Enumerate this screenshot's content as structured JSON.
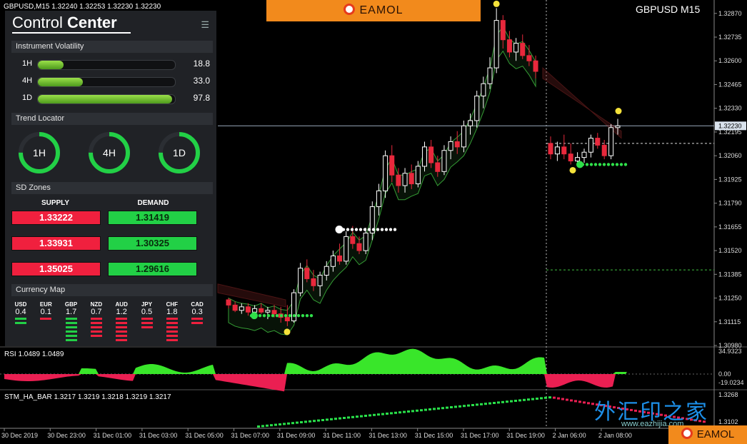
{
  "symbol_header": "GBPUSD,M15  1.32240 1.32253 1.32230 1.32230",
  "chart_title": "GBPUSD M15",
  "brand": "EAMOL",
  "colors": {
    "bull": "#ffffff",
    "bear": "#e8283c",
    "rsi_pos": "#39e62a",
    "rsi_neg": "#ea1f52",
    "band_up": "#3fbf3f",
    "band_down": "#d43b3b",
    "zone_supply": "#f0203e",
    "zone_demand": "#22d046",
    "accent": "#f28a1c"
  },
  "control_center": {
    "title_light": "Control ",
    "title_bold": "Center",
    "menu_icon": "hamburger-icon",
    "volatility": {
      "heading": "Instrument Volatility",
      "rows": [
        {
          "label": "1H",
          "value": "18.8",
          "fill": 0.188
        },
        {
          "label": "4H",
          "value": "33.0",
          "fill": 0.33
        },
        {
          "label": "1D",
          "value": "97.8",
          "fill": 0.978
        }
      ]
    },
    "trend_locator": {
      "heading": "Trend Locator",
      "rings": [
        {
          "label": "1H",
          "fill": 0.75
        },
        {
          "label": "4H",
          "fill": 0.75
        },
        {
          "label": "1D",
          "fill": 0.75
        }
      ]
    },
    "sd_zones": {
      "heading": "SD Zones",
      "supply_label": "SUPPLY",
      "demand_label": "DEMAND",
      "supply": [
        "1.33222",
        "1.33931",
        "1.35025"
      ],
      "demand": [
        "1.31419",
        "1.30325",
        "1.29616"
      ]
    },
    "currency_map": {
      "heading": "Currency Map",
      "items": [
        {
          "name": "USD",
          "value": "0.4",
          "bars": 2,
          "color": "#22d046"
        },
        {
          "name": "EUR",
          "value": "0.1",
          "bars": 1,
          "color": "#f0203e"
        },
        {
          "name": "GBP",
          "value": "1.7",
          "bars": 6,
          "color": "#22d046"
        },
        {
          "name": "NZD",
          "value": "0.7",
          "bars": 5,
          "color": "#f0203e"
        },
        {
          "name": "AUD",
          "value": "1.2",
          "bars": 6,
          "color": "#f0203e"
        },
        {
          "name": "JPY",
          "value": "0.5",
          "bars": 3,
          "color": "#f0203e"
        },
        {
          "name": "CHF",
          "value": "1.8",
          "bars": 6,
          "color": "#f0203e"
        },
        {
          "name": "CAD",
          "value": "0.3",
          "bars": 2,
          "color": "#f0203e"
        }
      ]
    }
  },
  "price_axis": [
    "1.32870",
    "1.32735",
    "1.32600",
    "1.32465",
    "1.32330",
    "1.32195",
    "1.32060",
    "1.31925",
    "1.31790",
    "1.31655",
    "1.31520",
    "1.31385",
    "1.31250",
    "1.31115",
    "1.30980"
  ],
  "current_price": "1.32230",
  "rsi": {
    "label": "RSI 1.0489 1.0489",
    "levels": [
      "34.9323",
      "0.00",
      "-19.0234"
    ]
  },
  "stm": {
    "label": "STM_HA_BAR 1.3217 1.3219 1.3218 1.3219 1.3217",
    "levels": [
      "1.3268",
      "1.3102"
    ]
  },
  "time_axis": [
    "30 Dec 2019",
    "30 Dec 23:00",
    "31 Dec 01:00",
    "31 Dec 03:00",
    "31 Dec 05:00",
    "31 Dec 07:00",
    "31 Dec 09:00",
    "31 Dec 11:00",
    "31 Dec 13:00",
    "31 Dec 15:00",
    "31 Dec 17:00",
    "31 Dec 19:00",
    "2 Jan 06:00",
    "2 Jan 08:00"
  ],
  "watermark": {
    "text": "外汇印之家",
    "url": "www.eazhijia.com"
  },
  "chart_data": {
    "type": "candlestick",
    "title": "GBPUSD M15",
    "ylim": [
      1.3098,
      1.3293
    ],
    "candles": [
      [
        1.3124,
        1.3125,
        1.3119,
        1.3121
      ],
      [
        1.3121,
        1.3123,
        1.3117,
        1.3118
      ],
      [
        1.3118,
        1.3122,
        1.3116,
        1.312
      ],
      [
        1.312,
        1.3122,
        1.3115,
        1.3117
      ],
      [
        1.3117,
        1.3121,
        1.3114,
        1.3119
      ],
      [
        1.3119,
        1.3122,
        1.3116,
        1.3117
      ],
      [
        1.3117,
        1.312,
        1.3113,
        1.3118
      ],
      [
        1.3118,
        1.3121,
        1.3114,
        1.3116
      ],
      [
        1.3116,
        1.312,
        1.3111,
        1.3114
      ],
      [
        1.3114,
        1.3121,
        1.3109,
        1.3112
      ],
      [
        1.3112,
        1.313,
        1.3111,
        1.3128
      ],
      [
        1.3128,
        1.3145,
        1.3126,
        1.3142
      ],
      [
        1.3142,
        1.3147,
        1.3134,
        1.3136
      ],
      [
        1.3136,
        1.3141,
        1.3129,
        1.3132
      ],
      [
        1.3132,
        1.314,
        1.3126,
        1.3138
      ],
      [
        1.3138,
        1.3146,
        1.3135,
        1.3143
      ],
      [
        1.3143,
        1.3152,
        1.314,
        1.3149
      ],
      [
        1.3149,
        1.3156,
        1.3144,
        1.3146
      ],
      [
        1.3146,
        1.3163,
        1.3144,
        1.316
      ],
      [
        1.316,
        1.3166,
        1.3153,
        1.3156
      ],
      [
        1.3156,
        1.316,
        1.315,
        1.3152
      ],
      [
        1.3152,
        1.3165,
        1.315,
        1.3162
      ],
      [
        1.3162,
        1.318,
        1.3158,
        1.3177
      ],
      [
        1.3177,
        1.319,
        1.3172,
        1.3186
      ],
      [
        1.3186,
        1.3209,
        1.3182,
        1.3206
      ],
      [
        1.3206,
        1.3212,
        1.3191,
        1.3195
      ],
      [
        1.3195,
        1.3199,
        1.3185,
        1.3189
      ],
      [
        1.3189,
        1.3199,
        1.3185,
        1.3196
      ],
      [
        1.3196,
        1.3201,
        1.3187,
        1.319
      ],
      [
        1.319,
        1.3203,
        1.3188,
        1.32
      ],
      [
        1.32,
        1.3214,
        1.3197,
        1.3211
      ],
      [
        1.3211,
        1.3215,
        1.3199,
        1.3202
      ],
      [
        1.3202,
        1.3206,
        1.3194,
        1.3197
      ],
      [
        1.3197,
        1.3212,
        1.3195,
        1.3209
      ],
      [
        1.3209,
        1.3217,
        1.3204,
        1.3214
      ],
      [
        1.3214,
        1.322,
        1.3207,
        1.3211
      ],
      [
        1.3211,
        1.3226,
        1.3208,
        1.3223
      ],
      [
        1.3223,
        1.323,
        1.3218,
        1.3226
      ],
      [
        1.3226,
        1.3243,
        1.3222,
        1.324
      ],
      [
        1.324,
        1.3251,
        1.3233,
        1.3247
      ],
      [
        1.3247,
        1.3262,
        1.3244,
        1.3256
      ],
      [
        1.3256,
        1.329,
        1.3253,
        1.3283
      ],
      [
        1.3283,
        1.3286,
        1.3267,
        1.3272
      ],
      [
        1.3272,
        1.3277,
        1.3262,
        1.3265
      ],
      [
        1.3265,
        1.3273,
        1.326,
        1.327
      ],
      [
        1.327,
        1.3275,
        1.3261,
        1.3263
      ],
      [
        1.3263,
        1.3269,
        1.3257,
        1.326
      ],
      [
        1.326,
        1.3263,
        1.325,
        1.3254
      ],
      [
        1.3213,
        1.3217,
        1.3204,
        1.3207
      ],
      [
        1.3207,
        1.3214,
        1.3203,
        1.3211
      ],
      [
        1.3211,
        1.3218,
        1.3204,
        1.3207
      ],
      [
        1.3207,
        1.3213,
        1.3201,
        1.3203
      ],
      [
        1.3203,
        1.3208,
        1.32,
        1.3205
      ],
      [
        1.3205,
        1.321,
        1.3202,
        1.3208
      ],
      [
        1.3208,
        1.3218,
        1.3205,
        1.3216
      ],
      [
        1.3216,
        1.3219,
        1.321,
        1.3212
      ],
      [
        1.3212,
        1.3215,
        1.3204,
        1.3206
      ],
      [
        1.3206,
        1.3224,
        1.3204,
        1.3222
      ],
      [
        1.3222,
        1.3227,
        1.3218,
        1.3223
      ]
    ]
  }
}
